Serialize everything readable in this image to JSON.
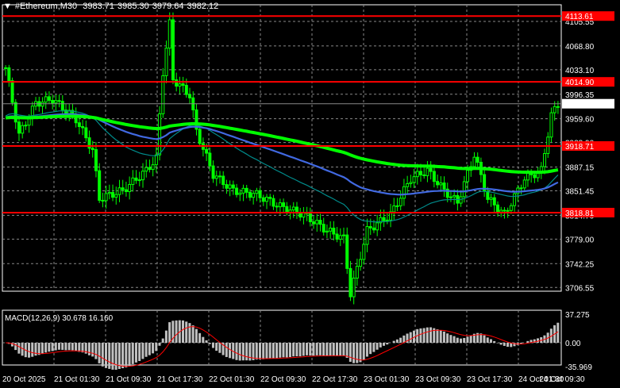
{
  "header": {
    "symbol": "#Ethereum,M30",
    "open": "3983.71",
    "high": "3985.30",
    "low": "3979.64",
    "close": "3982.12"
  },
  "price_axis": {
    "ticks": [
      "4105.55",
      "4068.80",
      "4033.10",
      "3996.35",
      "3959.60",
      "3923.90",
      "3887.15",
      "3851.45",
      "3814.70",
      "3779.00",
      "3742.25",
      "3706.55"
    ],
    "current_price": "3982.12"
  },
  "levels": [
    {
      "label": "4113.61",
      "price": 4113.61
    },
    {
      "label": "4014.90",
      "price": 4014.9
    },
    {
      "label": "3918.71",
      "price": 3918.71
    },
    {
      "label": "3818.81",
      "price": 3818.81
    }
  ],
  "time_axis": [
    "20 Oct 2025",
    "21 Oct 01:30",
    "21 Oct 09:30",
    "21 Oct 17:30",
    "22 Oct 01:30",
    "22 Oct 09:30",
    "22 Oct 17:30",
    "23 Oct 01:30",
    "23 Oct 09:30",
    "23 Oct 17:30",
    "24 Oct 01:30",
    "24 Oct 09:30"
  ],
  "macd": {
    "label": "MACD(12,26,9) 30.678 16.160",
    "ticks": [
      "37.275",
      "0.00",
      "-35.969"
    ]
  },
  "price_keyframes": [
    [
      0,
      4036
    ],
    [
      4,
      3935
    ],
    [
      9,
      3983
    ],
    [
      14,
      3989
    ],
    [
      21,
      3959
    ],
    [
      26,
      3912
    ],
    [
      28,
      3840
    ],
    [
      35,
      3852
    ],
    [
      42,
      3882
    ],
    [
      45,
      3900
    ],
    [
      47,
      4030
    ],
    [
      49,
      4102
    ],
    [
      50,
      4019
    ],
    [
      55,
      3995
    ],
    [
      57,
      3941
    ],
    [
      62,
      3876
    ],
    [
      68,
      3852
    ],
    [
      75,
      3846
    ],
    [
      82,
      3828
    ],
    [
      89,
      3816
    ],
    [
      96,
      3792
    ],
    [
      101,
      3780
    ],
    [
      103,
      3697
    ],
    [
      108,
      3792
    ],
    [
      115,
      3816
    ],
    [
      121,
      3870
    ],
    [
      126,
      3882
    ],
    [
      131,
      3852
    ],
    [
      135,
      3834
    ],
    [
      140,
      3906
    ],
    [
      144,
      3840
    ],
    [
      149,
      3816
    ],
    [
      155,
      3870
    ],
    [
      160,
      3882
    ],
    [
      163,
      3965
    ],
    [
      165,
      3982
    ]
  ],
  "colors": {
    "level": "#ff0000",
    "bull": "#00ff00",
    "bear": "#00ff00",
    "ma_fast": "#008b8b",
    "ma_mid": "#4169e1",
    "ma_slow": "#00ff00",
    "macd_hist": "#c0c0c0",
    "macd_signal": "#ff0000"
  }
}
